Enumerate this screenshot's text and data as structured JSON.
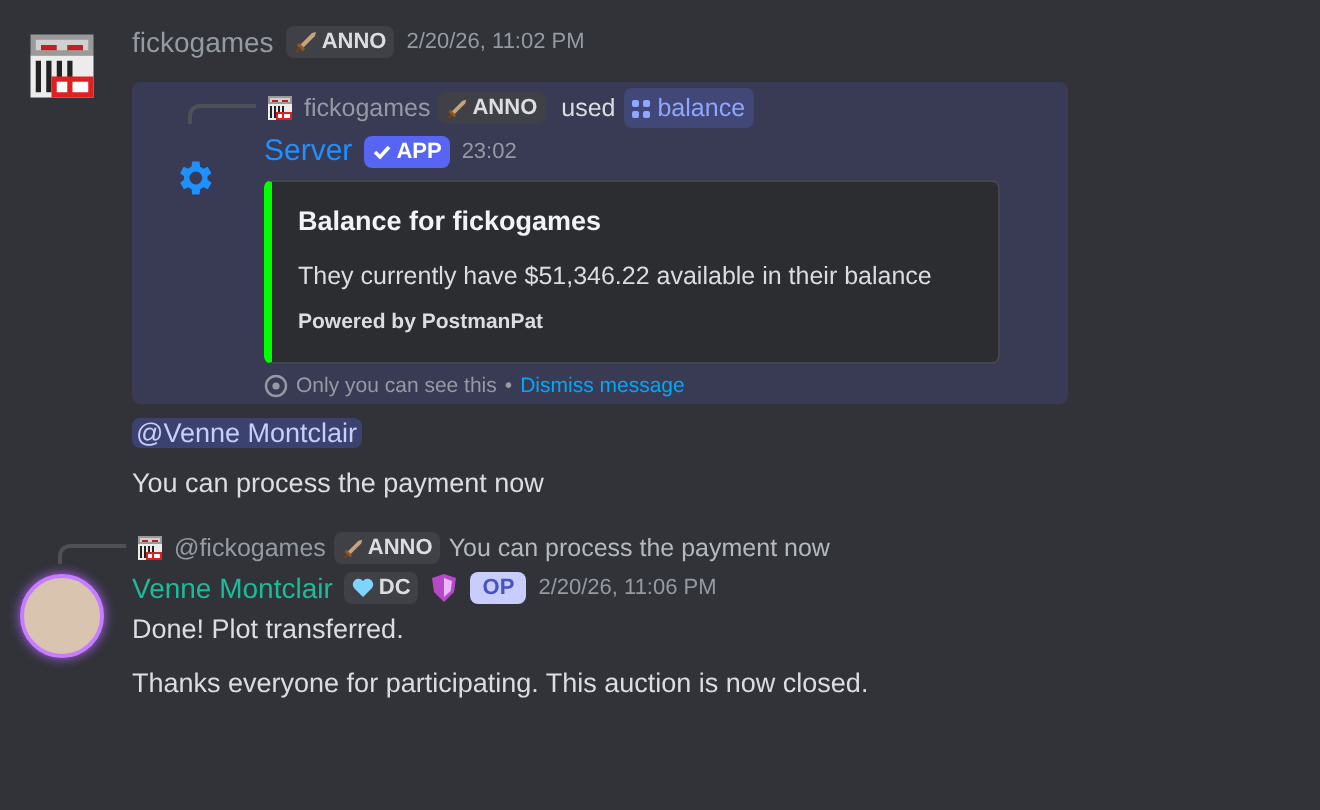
{
  "messages": [
    {
      "author": "fickogames",
      "tag": "ANNO",
      "time": "2/20/26, 11:02 PM",
      "interaction": {
        "reply_user": "fickogames",
        "reply_tag": "ANNO",
        "used": "used",
        "command": "balance",
        "bot": "Server",
        "bot_badge": "APP",
        "bot_time": "23:02",
        "embed": {
          "title": "Balance for fickogames",
          "body": "They currently have $51,346.22 available in their balance",
          "footer": "Powered by PostmanPat"
        },
        "notice": "Only you can see this",
        "notice_sep": "•",
        "dismiss": "Dismiss message"
      },
      "lines": [
        {
          "kind": "mention",
          "text": "@Venne Montclair"
        },
        {
          "kind": "text",
          "text": "You can process the payment now"
        }
      ]
    },
    {
      "reply": {
        "user": "@fickogames",
        "tag": "ANNO",
        "text": "You can process the payment now"
      },
      "author": "Venne Montclair",
      "tag": "DC",
      "badge": "OP",
      "time": "2/20/26, 11:06 PM",
      "lines": [
        {
          "kind": "text",
          "text": "Done! Plot transferred."
        },
        {
          "kind": "text",
          "text": "Thanks everyone for participating. This auction is now closed."
        }
      ]
    }
  ]
}
